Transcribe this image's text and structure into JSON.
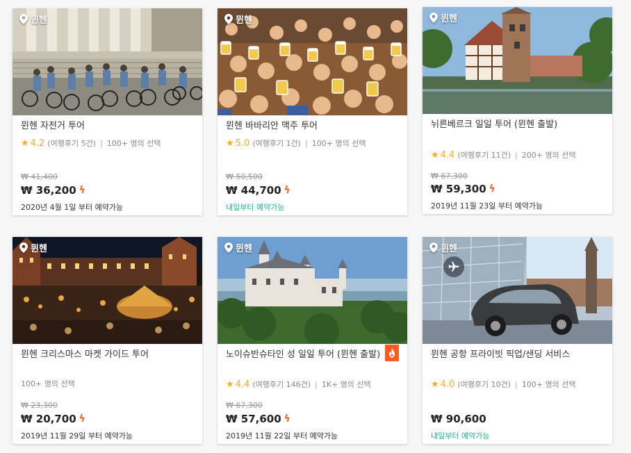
{
  "cards": [
    {
      "location": "뮌헨",
      "title": "뮌헨 자전거 투어",
      "rating": "4.2",
      "reviews": "(여행후기 5건)",
      "chosen": "100+ 명의 선택",
      "original_price": "₩ 41,400",
      "price": "₩ 36,200",
      "availability": "2020년 4월 1일 부터 예약가능"
    },
    {
      "location": "뮌헨",
      "title": "뮌헨 바바리안 맥주 투어",
      "rating": "5.0",
      "reviews": "(여행후기 1건)",
      "chosen": "100+ 명의 선택",
      "original_price": "₩ 50,500",
      "price": "₩ 44,700",
      "availability": "내일부터 예약가능"
    },
    {
      "location": "뮌헨",
      "title": "뉘른베르크 일일 투어 (뮌헨 출발)",
      "rating": "4.4",
      "reviews": "(여행후기 11건)",
      "chosen": "200+ 명의 선택",
      "original_price": "₩ 67,300",
      "price": "₩ 59,300",
      "availability": "2019년 11월 23일 부터 예약가능"
    },
    {
      "location": "뮌헨",
      "title": "뮌헨 크리스마스 마켓 가이드 투어",
      "chosen": "100+ 명의 선택",
      "original_price": "₩ 23,300",
      "price": "₩ 20,700",
      "availability": "2019년 11월 29일 부터 예약가능"
    },
    {
      "location": "뮌헨",
      "title": "노이슈반슈타인 성 일일 투어 (뮌헨 출발)",
      "rating": "4.4",
      "reviews": "(여행후기 146건)",
      "chosen": "1K+ 명의 선택",
      "original_price": "₩ 67,300",
      "price": "₩ 57,600",
      "availability": "2019년 11월 22일 부터 예약가능"
    },
    {
      "location": "뮌헨",
      "title": "뮌헨 공항 프라이빗 픽업/샌딩 서비스",
      "rating": "4.0",
      "reviews": "(여행후기 10건)",
      "chosen": "100+ 명의 선택",
      "price": "₩ 90,600",
      "availability": "내일부터 예약가능"
    }
  ],
  "icons": {
    "location": "map-pin-icon",
    "rating": "star-icon",
    "instant": "lightning-bolt-icon",
    "hot": "flame-badge-icon",
    "airport": "airplane-icon"
  },
  "colors": {
    "star": "#ffaa22",
    "bolt": "#ff5a1f",
    "available_green": "#1fb58b"
  }
}
